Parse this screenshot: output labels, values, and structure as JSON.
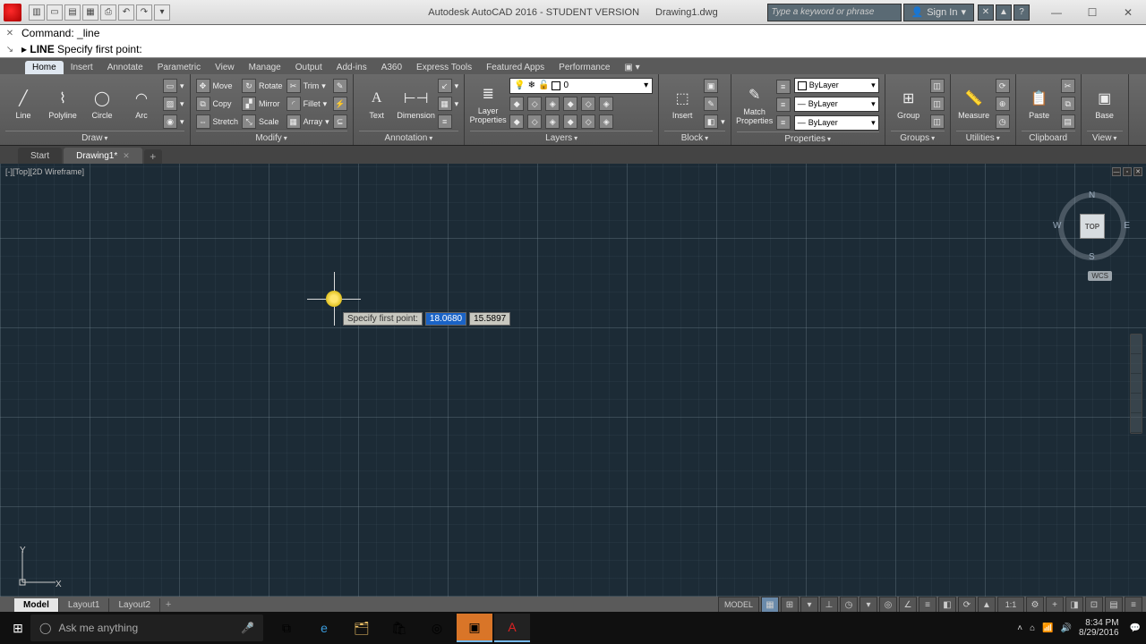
{
  "title": {
    "app": "Autodesk AutoCAD 2016 - STUDENT VERSION",
    "file": "Drawing1.dwg"
  },
  "searchPlaceholder": "Type a keyword or phrase",
  "signIn": "Sign In",
  "command": {
    "line1_prefix": "Command:",
    "line1_body": "_line",
    "line2_prefix": "LINE",
    "line2_body": "Specify first point:"
  },
  "tabs": [
    "Home",
    "Insert",
    "Annotate",
    "Parametric",
    "View",
    "Manage",
    "Output",
    "Add-ins",
    "A360",
    "Express Tools",
    "Featured Apps",
    "Performance"
  ],
  "activeTab": "Home",
  "panels": {
    "draw": {
      "title": "Draw",
      "tools": [
        "Line",
        "Polyline",
        "Circle",
        "Arc"
      ]
    },
    "modify": {
      "title": "Modify",
      "rows": [
        [
          "Move",
          "Rotate",
          "Trim"
        ],
        [
          "Copy",
          "Mirror",
          "Fillet"
        ],
        [
          "Stretch",
          "Scale",
          "Array"
        ]
      ]
    },
    "annotation": {
      "title": "Annotation",
      "tools": [
        "Text",
        "Dimension"
      ]
    },
    "layers": {
      "title": "Layers",
      "button": "Layer\nProperties",
      "current": "0"
    },
    "block": {
      "title": "Block",
      "button": "Insert"
    },
    "properties": {
      "title": "Properties",
      "button": "Match\nProperties",
      "color": "ByLayer",
      "lw": "ByLayer",
      "lt": "ByLayer"
    },
    "groups": {
      "title": "Groups",
      "button": "Group"
    },
    "utilities": {
      "title": "Utilities",
      "button": "Measure"
    },
    "clipboard": {
      "title": "Clipboard",
      "button": "Paste"
    },
    "view": {
      "title": "View",
      "button": "Base"
    }
  },
  "fileTabs": {
    "start": "Start",
    "active": "Drawing1*"
  },
  "viewport": {
    "label": "[-][Top][2D Wireframe]"
  },
  "dynInput": {
    "prompt": "Specify first point:",
    "x": "18.0680",
    "y": "15.5897"
  },
  "viewcube": {
    "face": "TOP",
    "n": "N",
    "s": "S",
    "e": "E",
    "w": "W",
    "wcs": "WCS"
  },
  "ucs": {
    "x": "X",
    "y": "Y"
  },
  "layoutTabs": [
    "Model",
    "Layout1",
    "Layout2"
  ],
  "status": {
    "model": "MODEL",
    "scale": "1:1"
  },
  "taskbar": {
    "searchPlaceholder": "Ask me anything",
    "time": "8:34 PM",
    "date": "8/29/2016"
  }
}
